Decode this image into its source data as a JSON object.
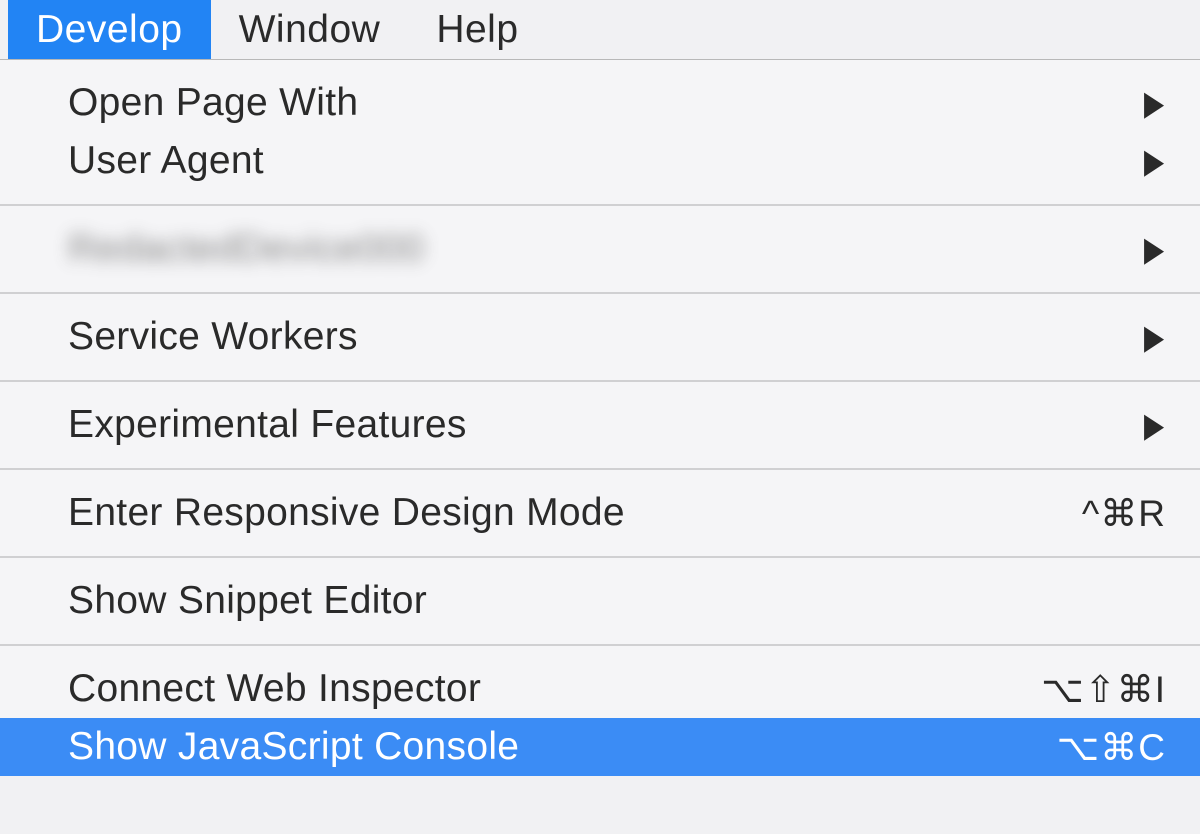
{
  "menubar": {
    "items": [
      {
        "label": "Develop",
        "active": true
      },
      {
        "label": "Window",
        "active": false
      },
      {
        "label": "Help",
        "active": false
      }
    ]
  },
  "dropdown": {
    "sections": [
      {
        "items": [
          {
            "id": "open-page-with",
            "label": "Open Page With",
            "submenu": true
          },
          {
            "id": "user-agent",
            "label": "User Agent",
            "submenu": true
          }
        ]
      },
      {
        "items": [
          {
            "id": "redacted-device",
            "label": "RedactedDevice000",
            "submenu": true,
            "blurred": true
          }
        ]
      },
      {
        "items": [
          {
            "id": "service-workers",
            "label": "Service Workers",
            "submenu": true
          }
        ]
      },
      {
        "items": [
          {
            "id": "experimental-features",
            "label": "Experimental Features",
            "submenu": true
          }
        ]
      },
      {
        "items": [
          {
            "id": "enter-responsive-design-mode",
            "label": "Enter Responsive Design Mode",
            "shortcut": "^⌘R"
          }
        ]
      },
      {
        "items": [
          {
            "id": "show-snippet-editor",
            "label": "Show Snippet Editor"
          }
        ]
      },
      {
        "items": [
          {
            "id": "connect-web-inspector",
            "label": "Connect Web Inspector",
            "shortcut": "⌥⇧⌘I"
          },
          {
            "id": "show-javascript-console",
            "label": "Show JavaScript Console",
            "shortcut": "⌥⌘C",
            "highlighted": true
          }
        ]
      }
    ]
  }
}
